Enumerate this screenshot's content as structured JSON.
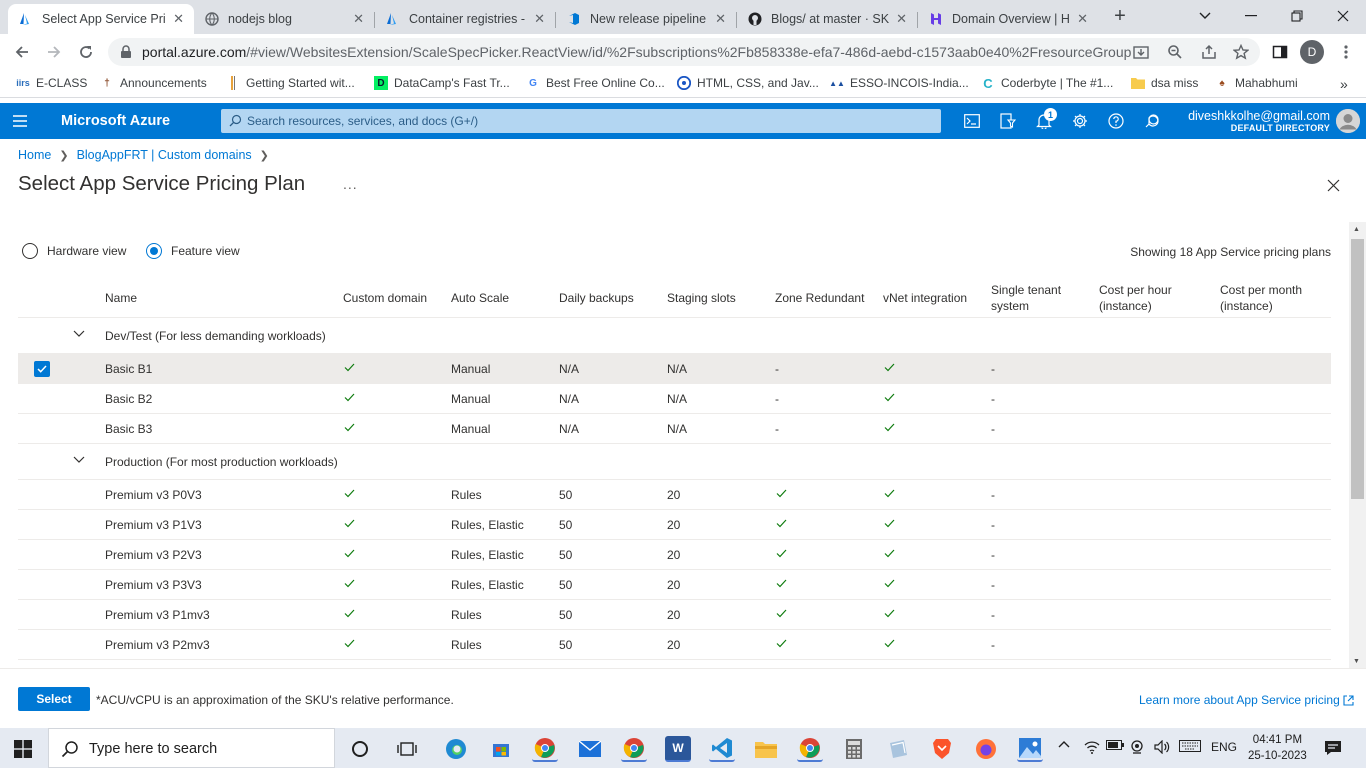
{
  "browser": {
    "tabs": [
      {
        "title": "Select App Service Pri",
        "icon": "azure-icon"
      },
      {
        "title": "nodejs blog",
        "icon": "globe-icon"
      },
      {
        "title": "Container registries -",
        "icon": "azure-icon"
      },
      {
        "title": "New release pipeline",
        "icon": "azure-devops-icon"
      },
      {
        "title": "Blogs/ at master · SK",
        "icon": "github-icon"
      },
      {
        "title": "Domain Overview | H",
        "icon": "hostinger-icon"
      }
    ],
    "url_domain": "portal.azure.com",
    "url_rest": "/#view/WebsitesExtension/ScaleSpecPicker.ReactView/id/%2Fsubscriptions%2Fb858338e-efa7-486d-aebd-c1573aab0e40%2FresourceGroup...",
    "profile_initial": "D",
    "bookmarks": [
      {
        "label": "E-CLASS",
        "icon": "iirs-icon"
      },
      {
        "label": "Announcements",
        "icon": "pin-icon"
      },
      {
        "label": "Getting Started wit...",
        "icon": "bookmark-icon"
      },
      {
        "label": "DataCamp's Fast Tr...",
        "icon": "datacamp-icon"
      },
      {
        "label": "Best Free Online Co...",
        "icon": "g-icon"
      },
      {
        "label": "HTML, CSS, and Jav...",
        "icon": "freecodecamp-icon"
      },
      {
        "label": "ESSO-INCOIS-India...",
        "icon": "incois-icon"
      },
      {
        "label": "Coderbyte | The #1...",
        "icon": "coderbyte-icon"
      },
      {
        "label": "dsa miss",
        "icon": "folder-icon"
      },
      {
        "label": "Mahabhumi",
        "icon": "mahabhumi-icon"
      }
    ]
  },
  "azure": {
    "brand": "Microsoft Azure",
    "search_placeholder": "Search resources, services, and docs (G+/)",
    "notification_count": "1",
    "user_email": "diveshkkolhe@gmail.com",
    "user_directory": "DEFAULT DIRECTORY"
  },
  "breadcrumb": [
    "Home",
    "BlogAppFRT | Custom domains"
  ],
  "page": {
    "title": "Select App Service Pricing Plan",
    "ellipsis": "...",
    "view_hardware": "Hardware view",
    "view_feature": "Feature view",
    "selected_view": "Feature view",
    "showing": "Showing 18 App Service pricing plans"
  },
  "table": {
    "headers": {
      "name": "Name",
      "custom_domain": "Custom domain",
      "auto_scale": "Auto Scale",
      "daily_backups": "Daily backups",
      "staging_slots": "Staging slots",
      "zone_redundant": "Zone Redundant",
      "vnet": "vNet integration",
      "single_tenant_1": "Single tenant",
      "single_tenant_2": "system",
      "cost_hour_1": "Cost per hour",
      "cost_hour_2": "(instance)",
      "cost_month_1": "Cost per month",
      "cost_month_2": "(instance)"
    },
    "groups": [
      {
        "label": "Dev/Test  (For less demanding workloads)",
        "rows": [
          {
            "name": "Basic B1",
            "custom_domain": true,
            "auto_scale": "Manual",
            "daily_backups": "N/A",
            "staging_slots": "N/A",
            "zone_redundant": "-",
            "vnet": true,
            "single_tenant": "-",
            "selected": true
          },
          {
            "name": "Basic B2",
            "custom_domain": true,
            "auto_scale": "Manual",
            "daily_backups": "N/A",
            "staging_slots": "N/A",
            "zone_redundant": "-",
            "vnet": true,
            "single_tenant": "-",
            "selected": false
          },
          {
            "name": "Basic B3",
            "custom_domain": true,
            "auto_scale": "Manual",
            "daily_backups": "N/A",
            "staging_slots": "N/A",
            "zone_redundant": "-",
            "vnet": true,
            "single_tenant": "-",
            "selected": false
          }
        ]
      },
      {
        "label": "Production  (For most production workloads)",
        "rows": [
          {
            "name": "Premium v3 P0V3",
            "custom_domain": true,
            "auto_scale": "Rules",
            "daily_backups": "50",
            "staging_slots": "20",
            "zone_redundant": true,
            "vnet": true,
            "single_tenant": "-",
            "selected": false
          },
          {
            "name": "Premium v3 P1V3",
            "custom_domain": true,
            "auto_scale": "Rules, Elastic",
            "daily_backups": "50",
            "staging_slots": "20",
            "zone_redundant": true,
            "vnet": true,
            "single_tenant": "-",
            "selected": false
          },
          {
            "name": "Premium v3 P2V3",
            "custom_domain": true,
            "auto_scale": "Rules, Elastic",
            "daily_backups": "50",
            "staging_slots": "20",
            "zone_redundant": true,
            "vnet": true,
            "single_tenant": "-",
            "selected": false
          },
          {
            "name": "Premium v3 P3V3",
            "custom_domain": true,
            "auto_scale": "Rules, Elastic",
            "daily_backups": "50",
            "staging_slots": "20",
            "zone_redundant": true,
            "vnet": true,
            "single_tenant": "-",
            "selected": false
          },
          {
            "name": "Premium v3 P1mv3",
            "custom_domain": true,
            "auto_scale": "Rules",
            "daily_backups": "50",
            "staging_slots": "20",
            "zone_redundant": true,
            "vnet": true,
            "single_tenant": "-",
            "selected": false
          },
          {
            "name": "Premium v3 P2mv3",
            "custom_domain": true,
            "auto_scale": "Rules",
            "daily_backups": "50",
            "staging_slots": "20",
            "zone_redundant": true,
            "vnet": true,
            "single_tenant": "-",
            "selected": false
          }
        ]
      }
    ]
  },
  "footer": {
    "select_label": "Select",
    "note": "*ACU/vCPU is an approximation of the SKU's relative performance.",
    "learn_more": "Learn more about App Service pricing"
  },
  "taskbar": {
    "search_placeholder": "Type here to search",
    "language": "ENG",
    "time": "04:41 PM",
    "date": "25-10-2023"
  },
  "colors": {
    "azure_blue": "#0078d4",
    "check_green": "#107c10"
  }
}
